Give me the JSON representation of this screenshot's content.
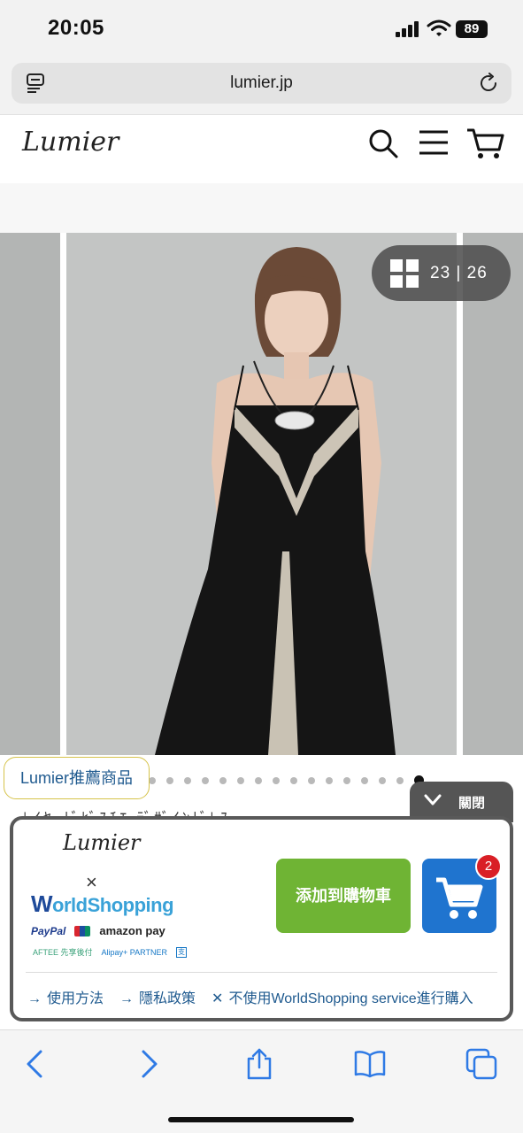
{
  "status_bar": {
    "time": "20:05",
    "battery": "89"
  },
  "browser": {
    "url": "lumier.jp"
  },
  "site": {
    "logo": "Lumier"
  },
  "gallery": {
    "counter": "23 | 26",
    "dot_count": 16,
    "active_dot": 15
  },
  "recommend_tag": "Lumier推薦商品",
  "close_tab": {
    "label": "關閉"
  },
  "behind_text": "ﾚｲﾔｰﾄﾞﾋﾞｽﾁｴ ﾃﾞｻﾞｲﾝﾄﾞﾚｽ",
  "worldshopping": {
    "logo": "Lumier",
    "times": "×",
    "brand_w": "W",
    "brand_rest": "orldShopping",
    "payments": {
      "paypal": "PayPal",
      "amazonpay": "amazon pay",
      "aftee": "AFTEE 先享後付",
      "alipay": "Alipay+ PARTNER",
      "alipay_mark": "支"
    },
    "add_to_cart_label": "添加到購物車",
    "cart_count": "2",
    "links": [
      "使用方法",
      "隱私政策",
      "不使用WorldShopping service進行購入"
    ]
  },
  "colors": {
    "add_to_cart": "#6fb434",
    "cart_button": "#1f74cf",
    "badge": "#d91f26",
    "tag_text": "#1f5a8f"
  }
}
